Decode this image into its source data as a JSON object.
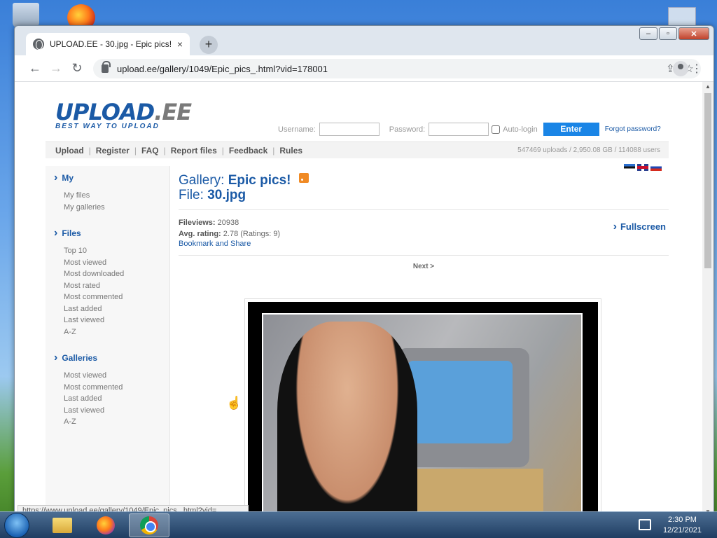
{
  "browser": {
    "tab_title": "UPLOAD.EE - 30.jpg - Epic pics!",
    "tab_close": "×",
    "new_tab": "+",
    "url": "upload.ee/gallery/1049/Epic_pics_.html?vid=178001",
    "status_url": "https://www.upload.ee/gallery/1049/Epic_pics_.html?vid=",
    "controls": {
      "minimize": "–",
      "maximize": "▫",
      "close": "✕"
    },
    "nav": {
      "back": "←",
      "forward": "→",
      "reload": "↻",
      "share": "⇪",
      "bookmark": "☆",
      "menu": "⋮"
    }
  },
  "site": {
    "logo_main": "UPLOAD",
    "logo_dot_ee": ".EE",
    "logo_tagline": "BEST WAY TO UPLOAD",
    "login": {
      "username_label": "Username:",
      "password_label": "Password:",
      "autologin_label": "Auto-login",
      "enter_label": "Enter",
      "forgot_label": "Forgot password?"
    },
    "menu": [
      "Upload",
      "Register",
      "FAQ",
      "Report files",
      "Feedback",
      "Rules"
    ],
    "menu_separator": "|",
    "stats": "547469 uploads  /  2,950.08 GB  /  114088 users",
    "flags": [
      "ee-flag-icon",
      "uk-flag-icon",
      "ru-flag-icon"
    ]
  },
  "sidebar": {
    "sections": [
      {
        "title": "My",
        "items": [
          "My files",
          "My galleries"
        ]
      },
      {
        "title": "Files",
        "items": [
          "Top 10",
          "Most viewed",
          "Most downloaded",
          "Most rated",
          "Most commented",
          "Last added",
          "Last viewed",
          "A-Z"
        ]
      },
      {
        "title": "Galleries",
        "items": [
          "Most viewed",
          "Most commented",
          "Last added",
          "Last viewed",
          "A-Z"
        ]
      }
    ]
  },
  "content": {
    "gallery_prefix": "Gallery: ",
    "gallery_name": "Epic pics!",
    "file_prefix": "File: ",
    "file_name": "30.jpg",
    "fileviews_label": "Fileviews:",
    "fileviews_value": "20938",
    "rating_label": "Avg. rating:",
    "rating_value": "2.78 (Ratings: 9)",
    "bookmark_text": "Bookmark and Share",
    "fullscreen_label": "Fullscreen",
    "next_label": "Next >"
  },
  "taskbar": {
    "time": "2:30 PM",
    "date": "12/21/2021",
    "apps": [
      "explorer-icon",
      "firefox-icon",
      "chrome-icon"
    ],
    "active_app": "chrome-icon"
  }
}
